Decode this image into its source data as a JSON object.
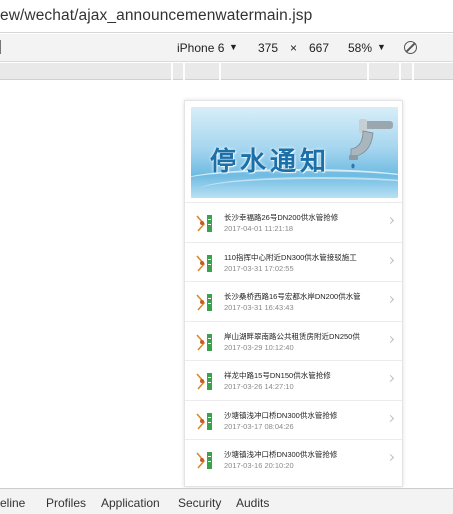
{
  "address_bar": {
    "url": "ew/wechat/ajax_announcemenwatermain.jsp"
  },
  "device_toolbar": {
    "device": "iPhone 6",
    "device_caret": "▼",
    "width": "375",
    "times": "×",
    "height": "667",
    "zoom": "58%",
    "zoom_caret": "▼",
    "throttle_icon": "no-action-icon"
  },
  "page": {
    "banner_title": "停水通知",
    "items": [
      {
        "title": "长沙幸福路26号DN200供水管抢修",
        "date": "2017-04-01 11:21:18"
      },
      {
        "title": "110指挥中心附近DN300供水管接驳施工",
        "date": "2017-03-31 17:02:55"
      },
      {
        "title": "长沙桑桥西路16号宏都水岸DN200供水管",
        "date": "2017-03-31 16:43:43"
      },
      {
        "title": "岸山湖畔翠南路公共租赁房附近DN250供",
        "date": "2017-03-29 10:12:40"
      },
      {
        "title": "祥龙中路15号DN150供水管抢修",
        "date": "2017-03-26 14:27:10"
      },
      {
        "title": "沙塘镇浅冲口桥DN300供水管抢修",
        "date": "2017-03-17 08:04:26"
      },
      {
        "title": "沙塘镇浅冲口桥DN300供水管抢修",
        "date": "2017-03-16 20:10:20"
      }
    ],
    "item_icon": "notice-thumbnail-icon",
    "chevron_icon": "chevron-right-icon"
  },
  "devtools_tabs": [
    "eline",
    "Profiles",
    "Application",
    "Security",
    "Audits"
  ],
  "colors": {
    "banner_text": "#1d6fa7",
    "thumb_green": "#3aa24a",
    "thumb_orange": "#d88a2c"
  }
}
